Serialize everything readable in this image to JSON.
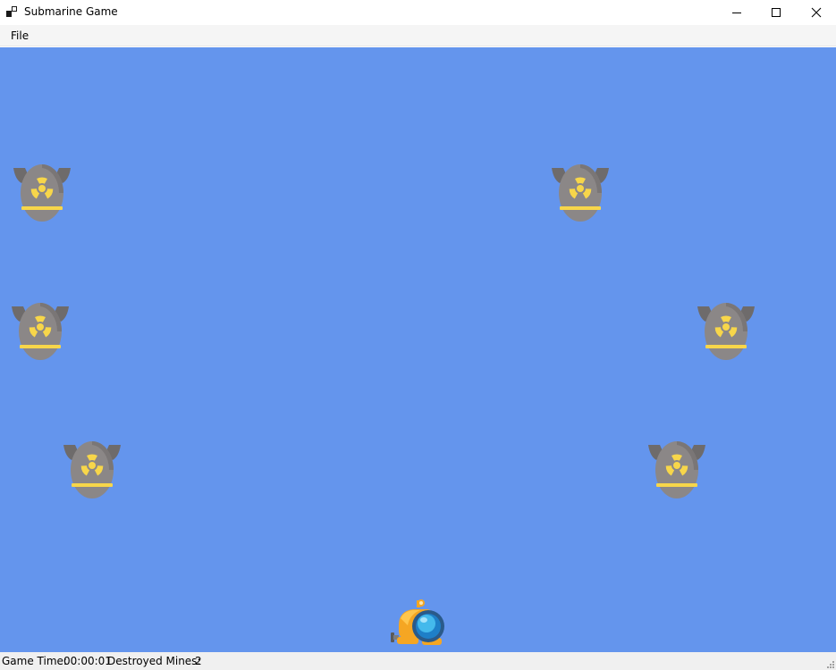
{
  "window": {
    "title": "Submarine Game",
    "icon": "app-window-icon",
    "controls": [
      "minimize-icon",
      "maximize-icon",
      "close-icon"
    ]
  },
  "menu": {
    "items": [
      {
        "label": "File"
      }
    ]
  },
  "game": {
    "background_color": "#6495ed",
    "mines": [
      {
        "type": "radioactive-mine"
      },
      {
        "type": "radioactive-mine"
      },
      {
        "type": "radioactive-mine"
      },
      {
        "type": "radioactive-mine"
      },
      {
        "type": "radioactive-mine"
      },
      {
        "type": "radioactive-mine"
      }
    ],
    "player": {
      "type": "submarine"
    }
  },
  "status": {
    "game_time_label": "Game Time:",
    "game_time_value": "00:00:01",
    "destroyed_label": "Destroyed Mines:",
    "destroyed_value": "2"
  }
}
